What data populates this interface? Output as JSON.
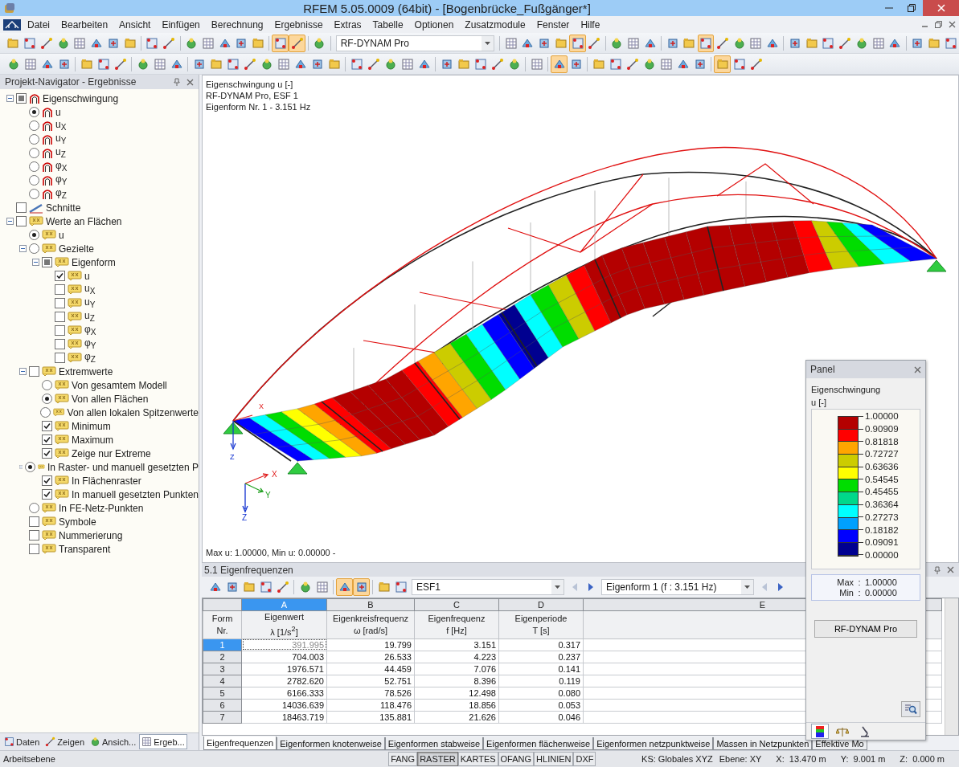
{
  "window": {
    "title": "RFEM 5.05.0009 (64bit) - [Bogenbrücke_Fußgänger*]"
  },
  "menu": [
    "Datei",
    "Bearbeiten",
    "Ansicht",
    "Einfügen",
    "Berechnung",
    "Ergebnisse",
    "Extras",
    "Tabelle",
    "Optionen",
    "Zusatzmodule",
    "Fenster",
    "Hilfe"
  ],
  "toolbar_1": [
    {
      "kind": "buttons",
      "pressed": [
        false,
        false,
        false,
        false,
        false,
        false,
        false,
        false
      ]
    },
    {
      "kind": "buttons",
      "pressed": [
        false,
        false
      ]
    },
    {
      "kind": "buttons",
      "pressed": [
        false,
        false,
        false,
        false,
        false
      ]
    },
    {
      "kind": "buttons",
      "pressed": [
        true,
        true
      ]
    },
    {
      "kind": "buttons",
      "pressed": [
        false
      ]
    },
    {
      "kind": "dropdown",
      "value": "RF-DYNAM Pro"
    },
    {
      "kind": "buttons",
      "pressed": [
        false,
        false,
        false,
        false,
        true,
        false
      ]
    },
    {
      "kind": "buttons",
      "pressed": [
        false,
        false,
        false
      ]
    },
    {
      "kind": "buttons",
      "pressed": [
        false,
        false,
        true,
        false,
        false,
        false,
        false
      ]
    },
    {
      "kind": "buttons",
      "pressed": [
        false,
        false,
        false,
        false,
        false,
        false,
        false
      ]
    },
    {
      "kind": "buttons",
      "pressed": [
        false,
        false,
        false
      ]
    }
  ],
  "toolbar_2": [
    {
      "kind": "buttons",
      "pressed": [
        false,
        false,
        false,
        false
      ]
    },
    {
      "kind": "buttons",
      "pressed": [
        false,
        false,
        false
      ]
    },
    {
      "kind": "buttons",
      "pressed": [
        false,
        false,
        false
      ]
    },
    {
      "kind": "buttons",
      "pressed": [
        false,
        false,
        false,
        false,
        false,
        false,
        false,
        false,
        false
      ]
    },
    {
      "kind": "buttons",
      "pressed": [
        false,
        false,
        false,
        false,
        false
      ]
    },
    {
      "kind": "buttons",
      "pressed": [
        false,
        false,
        false,
        false,
        false
      ]
    },
    {
      "kind": "buttons",
      "pressed": [
        false
      ]
    },
    {
      "kind": "buttons",
      "pressed": [
        true,
        false
      ]
    },
    {
      "kind": "buttons",
      "pressed": [
        false,
        false,
        false,
        false,
        false,
        false,
        false
      ]
    },
    {
      "kind": "buttons",
      "pressed": [
        true,
        false,
        false
      ]
    }
  ],
  "navigator": {
    "title": "Projekt-Navigator - Ergebnisse",
    "tree": [
      {
        "label": "Eigenschwingung",
        "kind": "checkbox",
        "partial": true,
        "expanded": true,
        "children": [
          {
            "label": "u",
            "kind": "radio",
            "checked": true
          },
          {
            "label": "u$_{X}$",
            "kind": "radio",
            "checked": false
          },
          {
            "label": "u$_{Y}$",
            "kind": "radio",
            "checked": false
          },
          {
            "label": "u$_{Z}$",
            "kind": "radio",
            "checked": false
          },
          {
            "label": "φ$_{X}$",
            "kind": "radio",
            "checked": false
          },
          {
            "label": "φ$_{Y}$",
            "kind": "radio",
            "checked": false
          },
          {
            "label": "φ$_{Z}$",
            "kind": "radio",
            "checked": false
          }
        ]
      },
      {
        "label": "Schnitte",
        "kind": "checkbox",
        "checked": false
      },
      {
        "label": "Werte an Flächen",
        "kind": "checkbox",
        "checked": false,
        "expanded": true,
        "children": [
          {
            "label": "u",
            "kind": "radio",
            "checked": true
          },
          {
            "label": "Gezielte",
            "kind": "radio",
            "checked": false,
            "expanded": true,
            "children": [
              {
                "label": "Eigenform",
                "kind": "checkbox",
                "partial": true,
                "expanded": true,
                "children": [
                  {
                    "label": "u",
                    "kind": "checkbox",
                    "checked": true
                  },
                  {
                    "label": "u$_{X}$",
                    "kind": "checkbox",
                    "checked": false
                  },
                  {
                    "label": "u$_{Y}$",
                    "kind": "checkbox",
                    "checked": false
                  },
                  {
                    "label": "u$_{Z}$",
                    "kind": "checkbox",
                    "checked": false
                  },
                  {
                    "label": "φ$_{X}$",
                    "kind": "checkbox",
                    "checked": false
                  },
                  {
                    "label": "φ$_{Y}$",
                    "kind": "checkbox",
                    "checked": false
                  },
                  {
                    "label": "φ$_{Z}$",
                    "kind": "checkbox",
                    "checked": false
                  }
                ]
              }
            ]
          },
          {
            "label": "Extremwerte",
            "kind": "checkbox",
            "checked": false,
            "expanded": true,
            "children": [
              {
                "label": "Von gesamtem Modell",
                "kind": "radio",
                "checked": false
              },
              {
                "label": "Von allen Flächen",
                "kind": "radio",
                "checked": true
              },
              {
                "label": "Von allen lokalen Spitzenwerte",
                "kind": "radio",
                "checked": false
              },
              {
                "label": "Minimum",
                "kind": "checkbox",
                "checked": true
              },
              {
                "label": "Maximum",
                "kind": "checkbox",
                "checked": true
              },
              {
                "label": "Zeige nur Extreme",
                "kind": "checkbox",
                "checked": true
              }
            ]
          },
          {
            "label": "In Raster- und manuell gesetzten P",
            "kind": "radio",
            "checked": true,
            "expanded": true,
            "children": [
              {
                "label": "In Flächenraster",
                "kind": "checkbox",
                "checked": true
              },
              {
                "label": "In manuell gesetzten Punkten",
                "kind": "checkbox",
                "checked": true
              }
            ]
          },
          {
            "label": "In FE-Netz-Punkten",
            "kind": "radio",
            "checked": false
          },
          {
            "label": "Symbole",
            "kind": "checkbox",
            "checked": false
          },
          {
            "label": "Nummerierung",
            "kind": "checkbox",
            "checked": false
          },
          {
            "label": "Transparent",
            "kind": "checkbox",
            "checked": false
          }
        ]
      }
    ],
    "tabs": [
      {
        "label": "Daten",
        "selected": false
      },
      {
        "label": "Zeigen",
        "selected": false
      },
      {
        "label": "Ansich...",
        "selected": false
      },
      {
        "label": "Ergeb...",
        "selected": true
      }
    ]
  },
  "view": {
    "info": [
      "Eigenschwingung u [-]",
      "RF-DYNAM Pro, ESF 1",
      "Eigenform Nr. 1 - 3.151 Hz"
    ],
    "support_labels": [
      "X",
      "Z"
    ],
    "triad": [
      "X",
      "Y",
      "Z"
    ],
    "footer": "Max u: 1.00000, Min u: 0.00000 -"
  },
  "table_panel": {
    "title": "5.1 Eigenfrequenzen",
    "toolbar": [
      {
        "kind": "buttons",
        "pressed": [
          false,
          false,
          false,
          false,
          false
        ]
      },
      {
        "kind": "buttons",
        "pressed": [
          false,
          false
        ]
      },
      {
        "kind": "buttons",
        "pressed": [
          true,
          true
        ]
      },
      {
        "kind": "buttons",
        "pressed": [
          false,
          false
        ]
      }
    ],
    "case": "ESF1",
    "mode": "Eigenform 1 (f : 3.151 Hz)",
    "row_header": [
      "Form",
      "Nr."
    ],
    "columns": [
      {
        "letter": "A",
        "line1": "Eigenwert",
        "line2": "λ [1/s$^{2}$]",
        "selected": true
      },
      {
        "letter": "B",
        "line1": "Eigenkreisfrequenz",
        "line2": "ω [rad/s]",
        "selected": false
      },
      {
        "letter": "C",
        "line1": "Eigenfrequenz",
        "line2": "f [Hz]",
        "selected": false
      },
      {
        "letter": "D",
        "line1": "Eigenperiode",
        "line2": "T [s]",
        "selected": false
      },
      {
        "letter": "E",
        "selected": false
      }
    ],
    "rows": [
      {
        "nr": "1",
        "cells": [
          "391.995",
          "19.799",
          "3.151",
          "0.317"
        ],
        "selected": true
      },
      {
        "nr": "2",
        "cells": [
          "704.003",
          "26.533",
          "4.223",
          "0.237"
        ],
        "selected": false
      },
      {
        "nr": "3",
        "cells": [
          "1976.571",
          "44.459",
          "7.076",
          "0.141"
        ],
        "selected": false
      },
      {
        "nr": "4",
        "cells": [
          "2782.620",
          "52.751",
          "8.396",
          "0.119"
        ],
        "selected": false
      },
      {
        "nr": "5",
        "cells": [
          "6166.333",
          "78.526",
          "12.498",
          "0.080"
        ],
        "selected": false
      },
      {
        "nr": "6",
        "cells": [
          "14036.639",
          "118.476",
          "18.856",
          "0.053"
        ],
        "selected": false
      },
      {
        "nr": "7",
        "cells": [
          "18463.719",
          "135.881",
          "21.626",
          "0.046"
        ],
        "selected": false
      }
    ],
    "sheets": [
      {
        "label": "Eigenfrequenzen",
        "selected": true
      },
      {
        "label": "Eigenformen knotenweise",
        "selected": false
      },
      {
        "label": "Eigenformen stabweise",
        "selected": false
      },
      {
        "label": "Eigenformen flächenweise",
        "selected": false
      },
      {
        "label": "Eigenformen netzpunktweise",
        "selected": false
      },
      {
        "label": "Massen in Netzpunkten",
        "selected": false
      },
      {
        "label": "Effektive Mo",
        "selected": false
      }
    ]
  },
  "panel": {
    "title": "Panel",
    "heading": "Eigenschwingung",
    "unit": "u [-]",
    "scale": [
      {
        "color": "#b40000"
      },
      {
        "color": "#ff0000"
      },
      {
        "color": "#ffa500"
      },
      {
        "color": "#cccc00"
      },
      {
        "color": "#ffff00"
      },
      {
        "color": "#00dd00"
      },
      {
        "color": "#00d88a"
      },
      {
        "color": "#00ffff"
      },
      {
        "color": "#00a0ff"
      },
      {
        "color": "#0000ff"
      },
      {
        "color": "#000090"
      }
    ],
    "ticks": [
      "1.00000",
      "0.90909",
      "0.81818",
      "0.72727",
      "0.63636",
      "0.54545",
      "0.45455",
      "0.36364",
      "0.27273",
      "0.18182",
      "0.09091",
      "0.00000"
    ],
    "max_label": "Max",
    "max": "1.00000",
    "min_label": "Min",
    "min": "0.00000",
    "separator": ":",
    "button": "RF-DYNAM Pro",
    "icon_tabs": [
      {
        "selected": true
      },
      {
        "selected": false
      },
      {
        "selected": false
      }
    ]
  },
  "status_bar": {
    "text": "Arbeitsebene",
    "toggles": [
      {
        "label": "FANG",
        "pressed": false
      },
      {
        "label": "RASTER",
        "pressed": true
      },
      {
        "label": "KARTES",
        "pressed": false
      },
      {
        "label": "OFANG",
        "pressed": false
      },
      {
        "label": "HLINIEN",
        "pressed": false
      },
      {
        "label": "DXF",
        "pressed": false
      }
    ],
    "info": [
      "KS: Globales XYZ",
      "Ebene: XY",
      "X:  13.470 m",
      "Y:  9.001 m",
      "Z:  0.000 m"
    ]
  }
}
